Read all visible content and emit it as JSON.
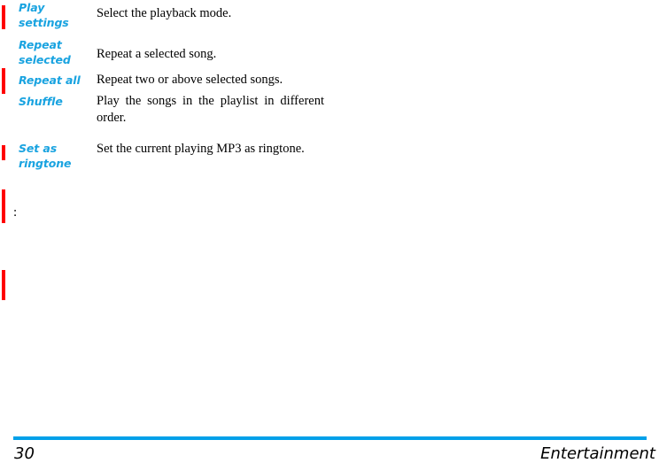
{
  "document": {
    "page_number": "30",
    "section_title": "Entertainment",
    "accent_blue": "#00a0e9",
    "label_blue": "#19a3e0",
    "marker_red": "#ff0000",
    "trailing_text": ":"
  },
  "feature_table": {
    "rows": [
      {
        "label": "Play\nsettings",
        "description": "Select the playback mode."
      },
      {
        "label": "Repeat\nselected",
        "description": "Repeat a selected song."
      },
      {
        "label": "Repeat all",
        "description": "Repeat two or above selected songs."
      },
      {
        "label": "Shuffle",
        "description": "Play the songs in the playlist in different order."
      },
      {
        "label": "Set as\nringtone",
        "description": "Set the current playing MP3 as ringtone."
      }
    ]
  }
}
